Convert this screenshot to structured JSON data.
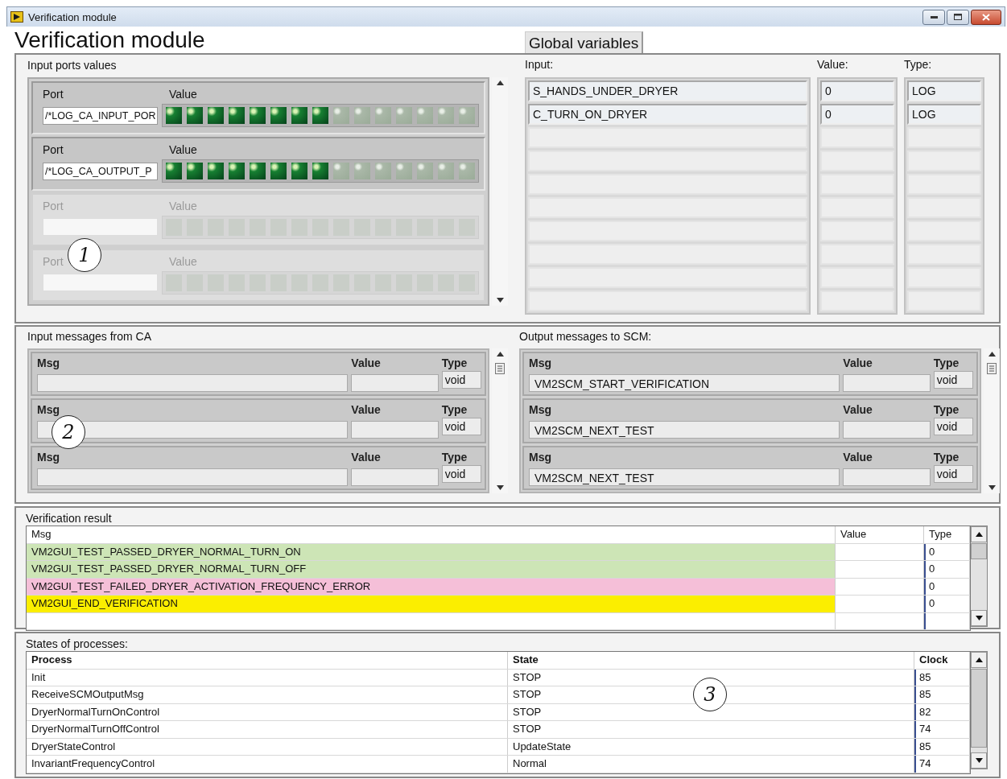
{
  "window": {
    "title": "Verification module"
  },
  "heading": "Verification module",
  "tabs": [
    {
      "label": "Global variables",
      "selected": true
    }
  ],
  "input_ports": {
    "title": "Input ports values",
    "clusters": [
      {
        "port_label": "Port",
        "value_label": "Value",
        "port": "/*LOG_CA_INPUT_POR",
        "disabled": false,
        "leds": [
          true,
          true,
          true,
          true,
          true,
          true,
          true,
          true,
          false,
          false,
          false,
          false,
          false,
          false,
          false
        ]
      },
      {
        "port_label": "Port",
        "value_label": "Value",
        "port": "/*LOG_CA_OUTPUT_P",
        "disabled": false,
        "leds": [
          true,
          true,
          true,
          true,
          true,
          true,
          true,
          true,
          false,
          false,
          false,
          false,
          false,
          false,
          false
        ]
      },
      {
        "port_label": "Port",
        "value_label": "Value",
        "disabled": true,
        "leds": [
          false,
          false,
          false,
          false,
          false,
          false,
          false,
          false,
          false,
          false,
          false,
          false,
          false,
          false,
          false
        ]
      },
      {
        "port_label": "Port",
        "value_label": "Value",
        "disabled": true,
        "leds": [
          false,
          false,
          false,
          false,
          false,
          false,
          false,
          false,
          false,
          false,
          false,
          false,
          false,
          false,
          false
        ]
      }
    ]
  },
  "global_variables": {
    "input_label": "Input:",
    "value_label": "Value:",
    "type_label": "Type:",
    "rows": [
      {
        "input": "S_HANDS_UNDER_DRYER",
        "value": "0",
        "type": "LOG"
      },
      {
        "input": "C_TURN_ON_DRYER",
        "value": "0",
        "type": "LOG"
      }
    ]
  },
  "input_messages": {
    "title": "Input messages from CA",
    "rows": [
      {
        "msg_label": "Msg",
        "value_label": "Value",
        "type_label": "Type",
        "type": "void"
      },
      {
        "msg_label": "Msg",
        "value_label": "Value",
        "type_label": "Type",
        "type": "void"
      },
      {
        "msg_label": "Msg",
        "value_label": "Value",
        "type_label": "Type",
        "type": "void"
      }
    ]
  },
  "output_messages": {
    "title": "Output messages to SCM:",
    "rows": [
      {
        "msg_label": "Msg",
        "value_label": "Value",
        "type_label": "Type",
        "msg": "VM2SCM_START_VERIFICATION",
        "type": "void"
      },
      {
        "msg_label": "Msg",
        "value_label": "Value",
        "type_label": "Type",
        "msg": "VM2SCM_NEXT_TEST",
        "type": "void"
      },
      {
        "msg_label": "Msg",
        "value_label": "Value",
        "type_label": "Type",
        "msg": "VM2SCM_NEXT_TEST",
        "type": "void"
      }
    ]
  },
  "verification_result": {
    "title": "Verification result",
    "columns": [
      "Msg",
      "Value",
      "Type"
    ],
    "rows": [
      {
        "msg": "VM2GUI_TEST_PASSED_DRYER_NORMAL_TURN_ON",
        "type": "0",
        "color": "#cde5b6"
      },
      {
        "msg": "VM2GUI_TEST_PASSED_DRYER_NORMAL_TURN_OFF",
        "type": "0",
        "color": "#cde5b6"
      },
      {
        "msg": "VM2GUI_TEST_FAILED_DRYER_ACTIVATION_FREQUENCY_ERROR",
        "type": "0",
        "color": "#f5bfd8"
      },
      {
        "msg": "VM2GUI_END_VERIFICATION",
        "type": "0",
        "color": "#fbee00"
      }
    ]
  },
  "processes": {
    "title": "States of processes:",
    "columns": [
      "Process",
      "State",
      "Clock"
    ],
    "rows": [
      {
        "process": "Init",
        "state": "STOP",
        "clock": "85"
      },
      {
        "process": "ReceiveSCMOutputMsg",
        "state": "STOP",
        "clock": "85"
      },
      {
        "process": "DryerNormalTurnOnControl",
        "state": "STOP",
        "clock": "82"
      },
      {
        "process": "DryerNormalTurnOffControl",
        "state": "STOP",
        "clock": "74"
      },
      {
        "process": "DryerStateControl",
        "state": "UpdateState",
        "clock": "85"
      },
      {
        "process": "InvariantFrequencyControl",
        "state": "Normal",
        "clock": "74"
      }
    ]
  },
  "callouts": [
    "1",
    "2",
    "3"
  ]
}
